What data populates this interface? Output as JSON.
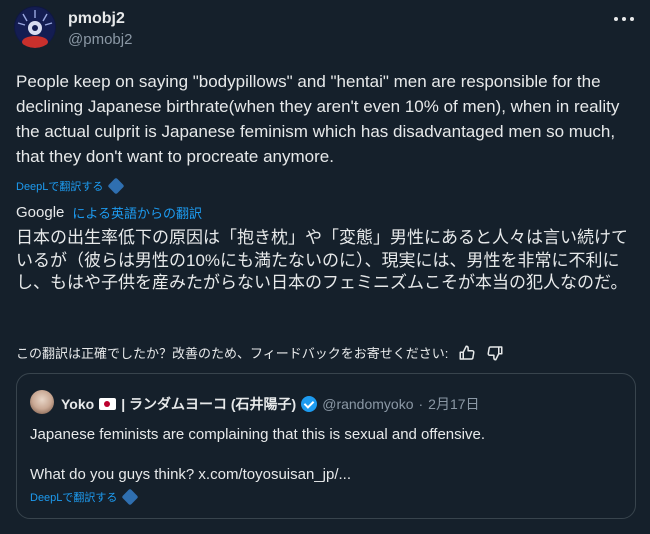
{
  "author": {
    "display_name": "pmobj2",
    "handle": "@pmobj2"
  },
  "tweet": {
    "text": "People keep on saying \"bodypillows\" and \"hentai\" men are responsible for the declining Japanese birthrate(when they aren't even 10% of men), when in reality the actual culprit is Japanese feminism which has disadvantaged men so much, that they don't want to procreate anymore.",
    "deepl_link": "DeepLで翻訳する"
  },
  "translation": {
    "provider_logo": "Google",
    "provider_desc": "による英語からの翻訳",
    "text": "日本の出生率低下の原因は「抱き枕」や「変態」男性にあると人々は言い続けているが（彼らは男性の10%にも満たないのに）、現実には、男性を非常に不利にし、もはや子供を産みたがらない日本のフェミニズムこそが本当の犯人なのだ。",
    "feedback": "この翻訳は正確でしたか？改善のため、フィードバックをお寄せください:"
  },
  "quote": {
    "name_prefix": "Yoko",
    "name_suffix": "| ランダムヨーコ (石井陽子)",
    "handle": "@randomyoko",
    "separator": "·",
    "date": "2月17日",
    "line1": "Japanese feminists are complaining that this is sexual and offensive.",
    "line2": "What do you guys think? x.com/toyosuisan_jp/...",
    "deepl_link": "DeepLで翻訳する"
  },
  "icons": [
    "more-icon",
    "deepl-icon",
    "thumbs-up-icon",
    "thumbs-down-icon",
    "verified-icon",
    "japan-flag-icon"
  ],
  "colors": {
    "background": "#15202b",
    "link": "#1d9bf0",
    "muted": "#8b98a5",
    "border": "#38444d"
  }
}
